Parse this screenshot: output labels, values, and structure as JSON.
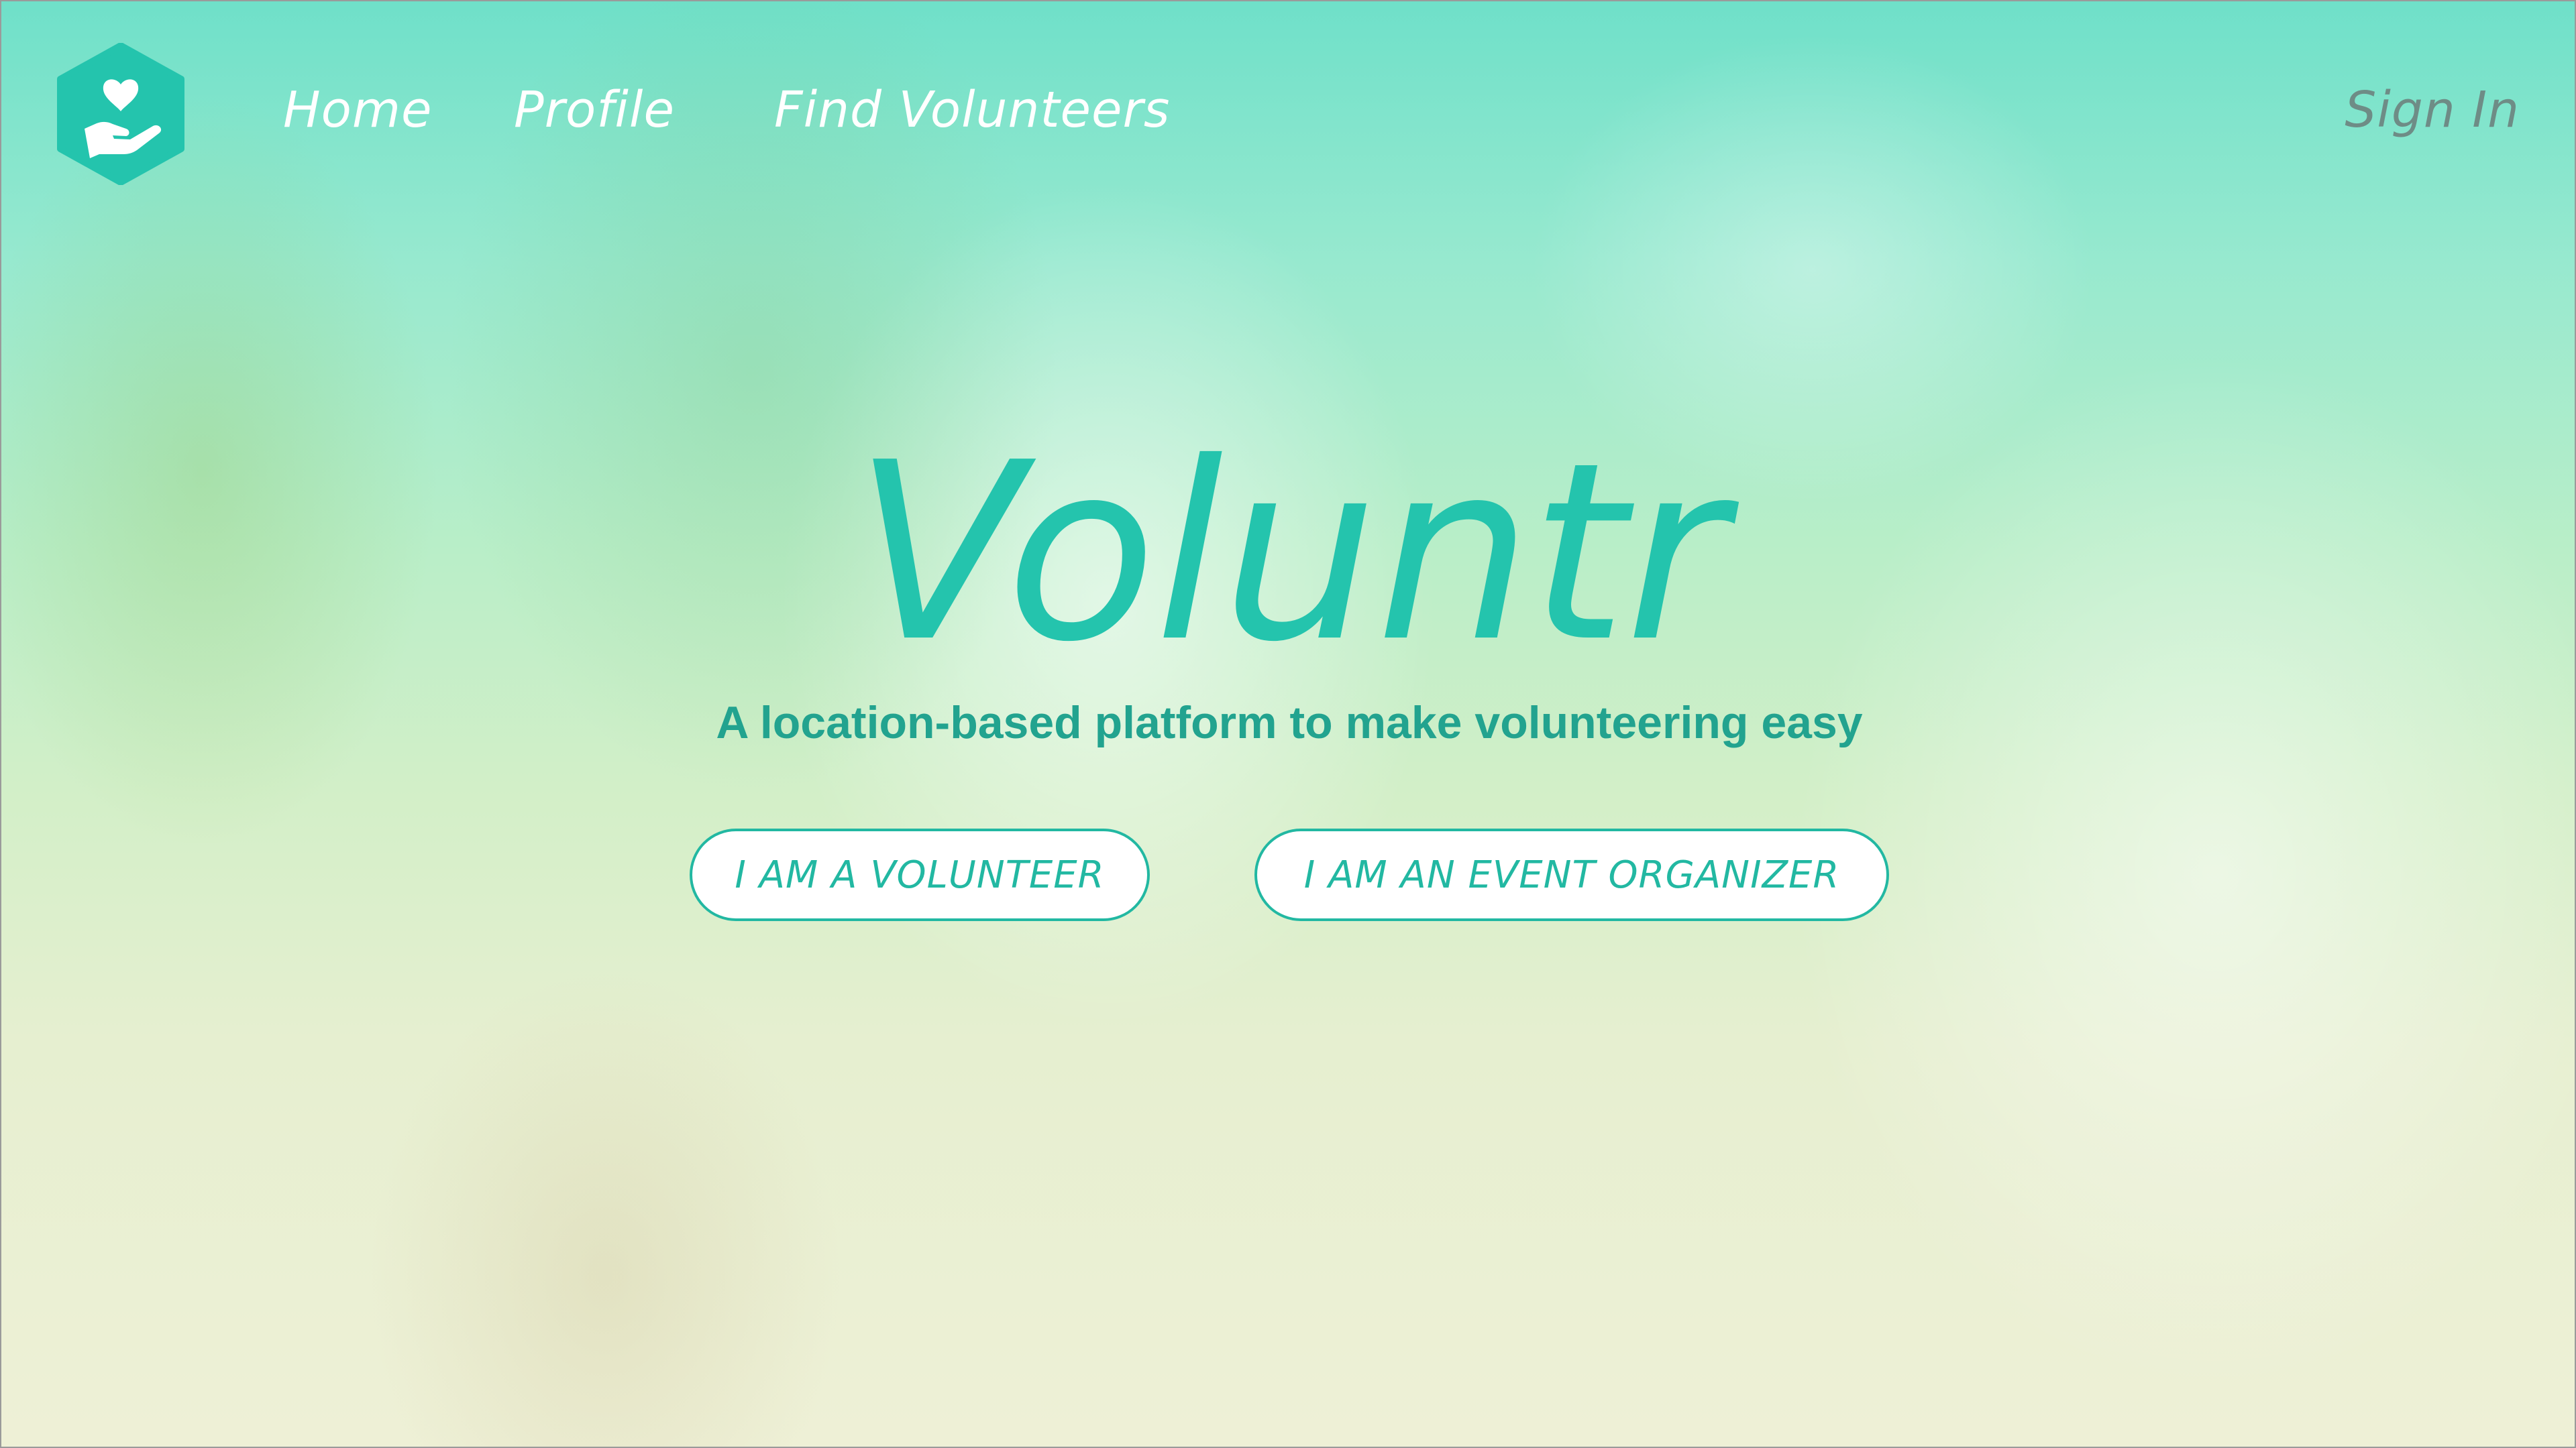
{
  "brand": {
    "logo_icon": "heart-in-hand-icon",
    "name": "Voluntr",
    "tagline": "A location-based platform to make volunteering easy"
  },
  "nav": {
    "home": "Home",
    "profile": "Profile",
    "find_volunteers": "Find Volunteers",
    "sign_in": "Sign In"
  },
  "actions": {
    "volunteer": "I AM A VOLUNTEER",
    "organizer": "I AM AN EVENT ORGANIZER"
  },
  "colors": {
    "accent": "#24c4ad",
    "accent_dark": "#22a38f",
    "nav_text": "#ffffff",
    "sign_in_text": "#6e8c86"
  }
}
